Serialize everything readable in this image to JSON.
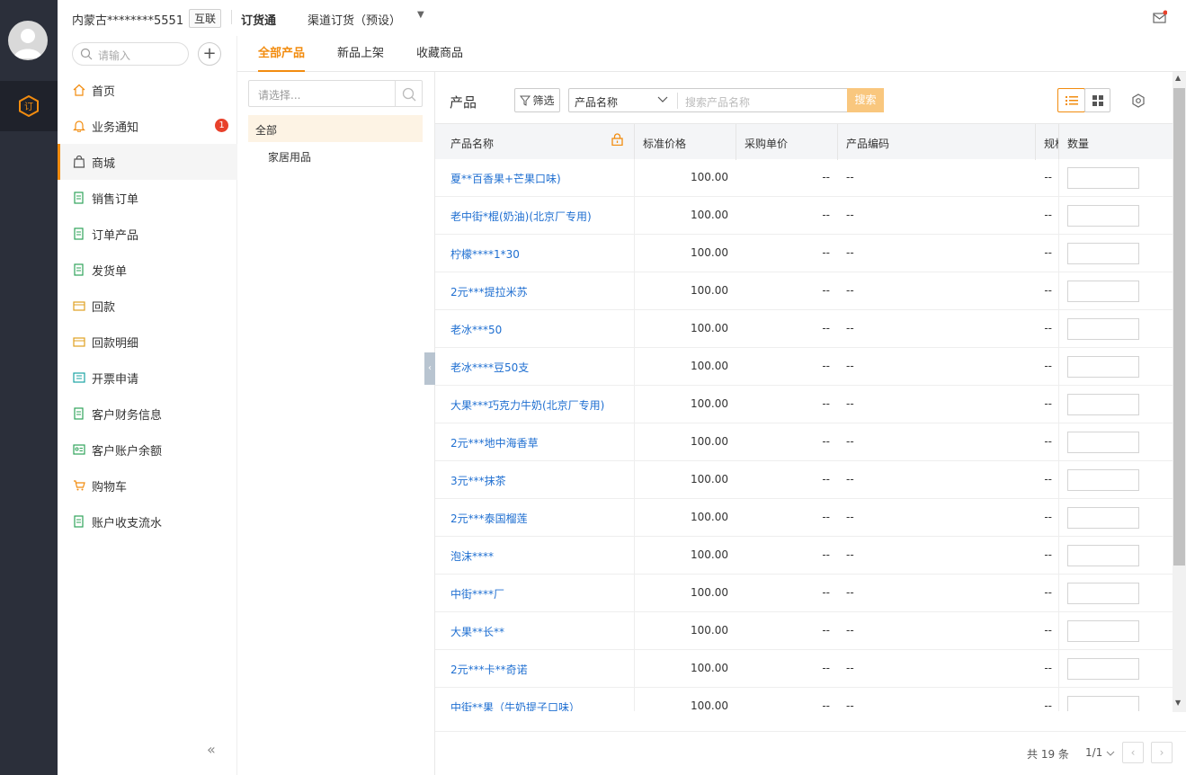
{
  "header": {
    "company": "内蒙古********5551",
    "company_tag": "互联",
    "app_name": "订货通",
    "channel": "渠道订货（预设）"
  },
  "sidebar": {
    "search_placeholder": "请输入",
    "items": [
      {
        "label": "首页",
        "icon": "home-icon"
      },
      {
        "label": "业务通知",
        "icon": "bell-icon",
        "badge": "1"
      },
      {
        "label": "商城",
        "icon": "bag-icon",
        "active": true
      },
      {
        "label": "销售订单",
        "icon": "document-icon"
      },
      {
        "label": "订单产品",
        "icon": "document-icon"
      },
      {
        "label": "发货单",
        "icon": "document-icon"
      },
      {
        "label": "回款",
        "icon": "card-icon"
      },
      {
        "label": "回款明细",
        "icon": "card-icon"
      },
      {
        "label": "开票申请",
        "icon": "invoice-icon"
      },
      {
        "label": "客户财务信息",
        "icon": "document-icon"
      },
      {
        "label": "客户账户余额",
        "icon": "id-card-icon"
      },
      {
        "label": "购物车",
        "icon": "cart-icon"
      },
      {
        "label": "账户收支流水",
        "icon": "document-icon"
      }
    ]
  },
  "tabs": [
    {
      "label": "全部产品",
      "active": true
    },
    {
      "label": "新品上架"
    },
    {
      "label": "收藏商品"
    }
  ],
  "categories": {
    "select_placeholder": "请选择...",
    "items": [
      {
        "label": "全部",
        "active": true
      },
      {
        "label": "家居用品"
      }
    ]
  },
  "toolbar": {
    "title": "产品",
    "filter_label": "筛选",
    "field_select": "产品名称",
    "search_placeholder": "搜索产品名称",
    "search_button": "搜索"
  },
  "table": {
    "columns": [
      "产品名称",
      "标准价格",
      "采购单价",
      "产品编码",
      "规格",
      "数量"
    ],
    "rows": [
      {
        "name": "夏**百香果+芒果口味)",
        "price": "100.00",
        "unit_price": "--",
        "code": "--",
        "spec": "--"
      },
      {
        "name": "老中街*棍(奶油)(北京厂专用)",
        "price": "100.00",
        "unit_price": "--",
        "code": "--",
        "spec": "--"
      },
      {
        "name": "柠檬****1*30",
        "price": "100.00",
        "unit_price": "--",
        "code": "--",
        "spec": "--"
      },
      {
        "name": "2元***提拉米苏",
        "price": "100.00",
        "unit_price": "--",
        "code": "--",
        "spec": "--"
      },
      {
        "name": "老冰***50",
        "price": "100.00",
        "unit_price": "--",
        "code": "--",
        "spec": "--"
      },
      {
        "name": "老冰****豆50支",
        "price": "100.00",
        "unit_price": "--",
        "code": "--",
        "spec": "--"
      },
      {
        "name": "大果***巧克力牛奶(北京厂专用)",
        "price": "100.00",
        "unit_price": "--",
        "code": "--",
        "spec": "--"
      },
      {
        "name": "2元***地中海香草",
        "price": "100.00",
        "unit_price": "--",
        "code": "--",
        "spec": "--"
      },
      {
        "name": "3元***抹茶",
        "price": "100.00",
        "unit_price": "--",
        "code": "--",
        "spec": "--"
      },
      {
        "name": "2元***泰国榴莲",
        "price": "100.00",
        "unit_price": "--",
        "code": "--",
        "spec": "--"
      },
      {
        "name": "泡沫****",
        "price": "100.00",
        "unit_price": "--",
        "code": "--",
        "spec": "--"
      },
      {
        "name": "中街****厂",
        "price": "100.00",
        "unit_price": "--",
        "code": "--",
        "spec": "--"
      },
      {
        "name": "大果**长**",
        "price": "100.00",
        "unit_price": "--",
        "code": "--",
        "spec": "--"
      },
      {
        "name": "2元***卡**奇诺",
        "price": "100.00",
        "unit_price": "--",
        "code": "--",
        "spec": "--"
      },
      {
        "name": "中街**果（牛奶提子口味）",
        "price": "100.00",
        "unit_price": "--",
        "code": "--",
        "spec": "--"
      }
    ]
  },
  "pagination": {
    "total": "共 19 条",
    "page": "1/1"
  },
  "colors": {
    "accent": "#f28c0f",
    "rail": "#2b2f3a",
    "link": "#1f6fd1",
    "badge": "#e8412b"
  }
}
